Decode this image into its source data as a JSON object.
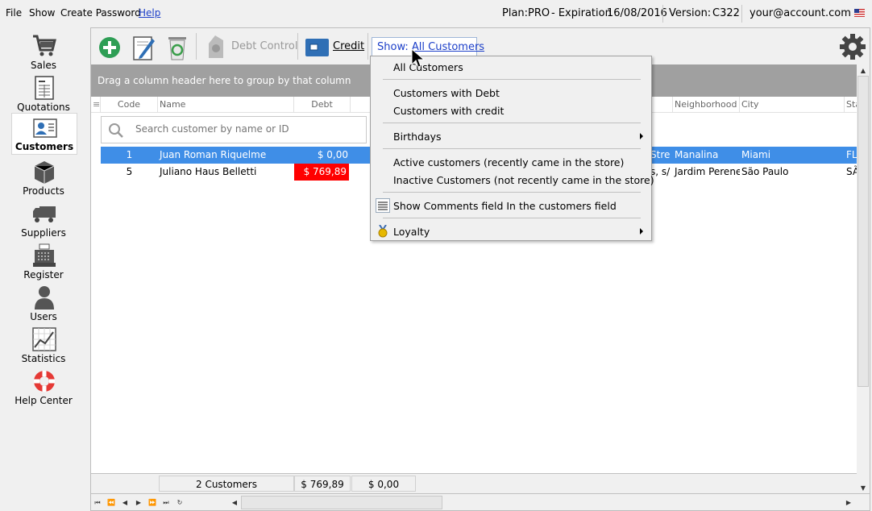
{
  "menu": {
    "file": "File",
    "show": "Show",
    "change_password": "Create Password",
    "help": "Help"
  },
  "status": {
    "plan_label": "Plan:",
    "plan_value": "PRO",
    "expiration_label": "- Expiration",
    "expiration_date": "16/08/2016",
    "version_label": "Version:",
    "version_value": "C322",
    "account": "your@account.com"
  },
  "sidebar": {
    "items": [
      {
        "label": "Sales",
        "icon": "cart-icon"
      },
      {
        "label": "Quotations",
        "icon": "document-icon"
      },
      {
        "label": "Customers",
        "icon": "customer-card-icon",
        "active": true
      },
      {
        "label": "Products",
        "icon": "box-icon"
      },
      {
        "label": "Suppliers",
        "icon": "truck-icon"
      },
      {
        "label": "Register",
        "icon": "cash-register-icon"
      },
      {
        "label": "Users",
        "icon": "user-icon"
      },
      {
        "label": "Statistics",
        "icon": "chart-icon"
      },
      {
        "label": "Help Center",
        "icon": "lifebuoy-icon"
      }
    ]
  },
  "toolbar": {
    "debt_control": "Debt Control",
    "credit": "Credit",
    "show_prefix": "Show:",
    "show_value": "All Customers"
  },
  "grid": {
    "group_hint": "Drag a column header here to group by that column",
    "columns": {
      "code": "Code",
      "name": "Name",
      "debt": "Debt",
      "neighborhood": "Neighborhood",
      "city": "City",
      "state": "Sta"
    },
    "search_placeholder": "Search customer by name or ID",
    "rows": [
      {
        "code": "1",
        "name": "Juan Roman Riquelme",
        "debt": "$ 0,00",
        "street": "Stre",
        "neighborhood": "Manalina",
        "city": "Miami",
        "state": "FL"
      },
      {
        "code": "5",
        "name": "Juliano Haus Belletti",
        "debt": "$ 769,89",
        "street": "s, s/",
        "neighborhood": "Jardim Perene",
        "city": "São Paulo",
        "state": "SÃ"
      }
    ],
    "footer": {
      "count": "2 Customers",
      "debt_total": "$ 769,89",
      "credit_total": "$ 0,00"
    }
  },
  "dropdown": {
    "all": "All Customers",
    "with_debt": "Customers with Debt",
    "with_credit": "Customers with credit",
    "birthdays": "Birthdays",
    "active": "Active customers (recently came in the store)",
    "inactive": "Inactive Customers (not recently came in the store)",
    "comments": "Show Comments field In the customers field",
    "loyalty": "Loyalty"
  },
  "colors": {
    "selected_row": "#3f8ee7",
    "debt_red": "#ff0000",
    "group_bar": "#a0a0a0",
    "link_blue": "#1c3fc9"
  }
}
